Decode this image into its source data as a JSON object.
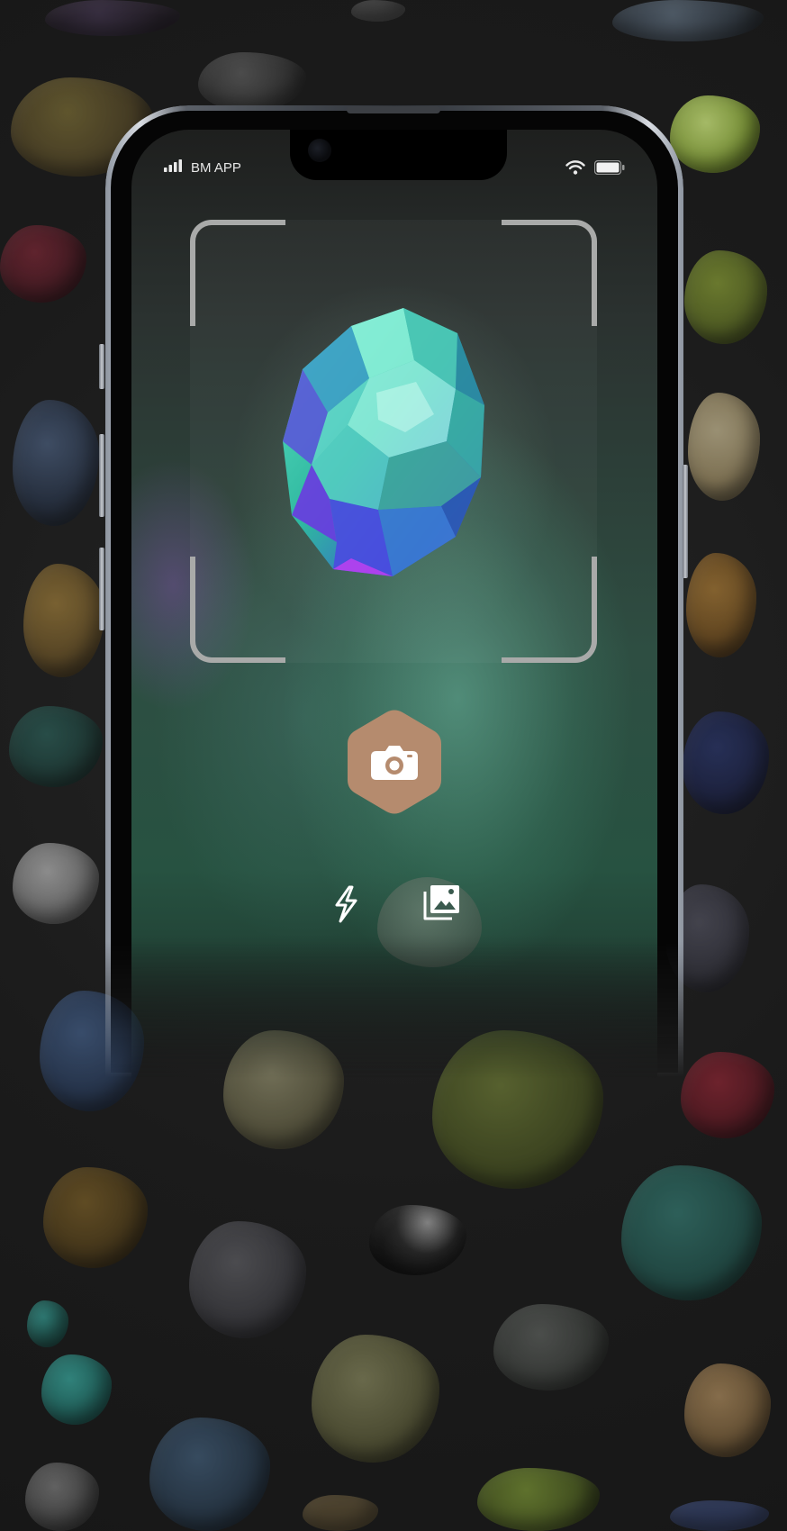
{
  "status_bar": {
    "carrier": "BM APP",
    "signal_icon": "signal-bars-icon",
    "wifi_icon": "wifi-icon",
    "battery_icon": "battery-icon",
    "battery_level": 1.0
  },
  "scanner": {
    "frame_icon": "scan-frame-corners",
    "subject": "crystal-gem-image"
  },
  "controls": {
    "shutter_icon": "camera-icon",
    "flash_icon": "flash-icon",
    "gallery_icon": "gallery-icon"
  },
  "colors": {
    "background": "#1b1b1b",
    "shutter_fill": "#b58b6e",
    "frame_corners": "#a9aaa9",
    "screen_glow": "#3f7a63"
  }
}
